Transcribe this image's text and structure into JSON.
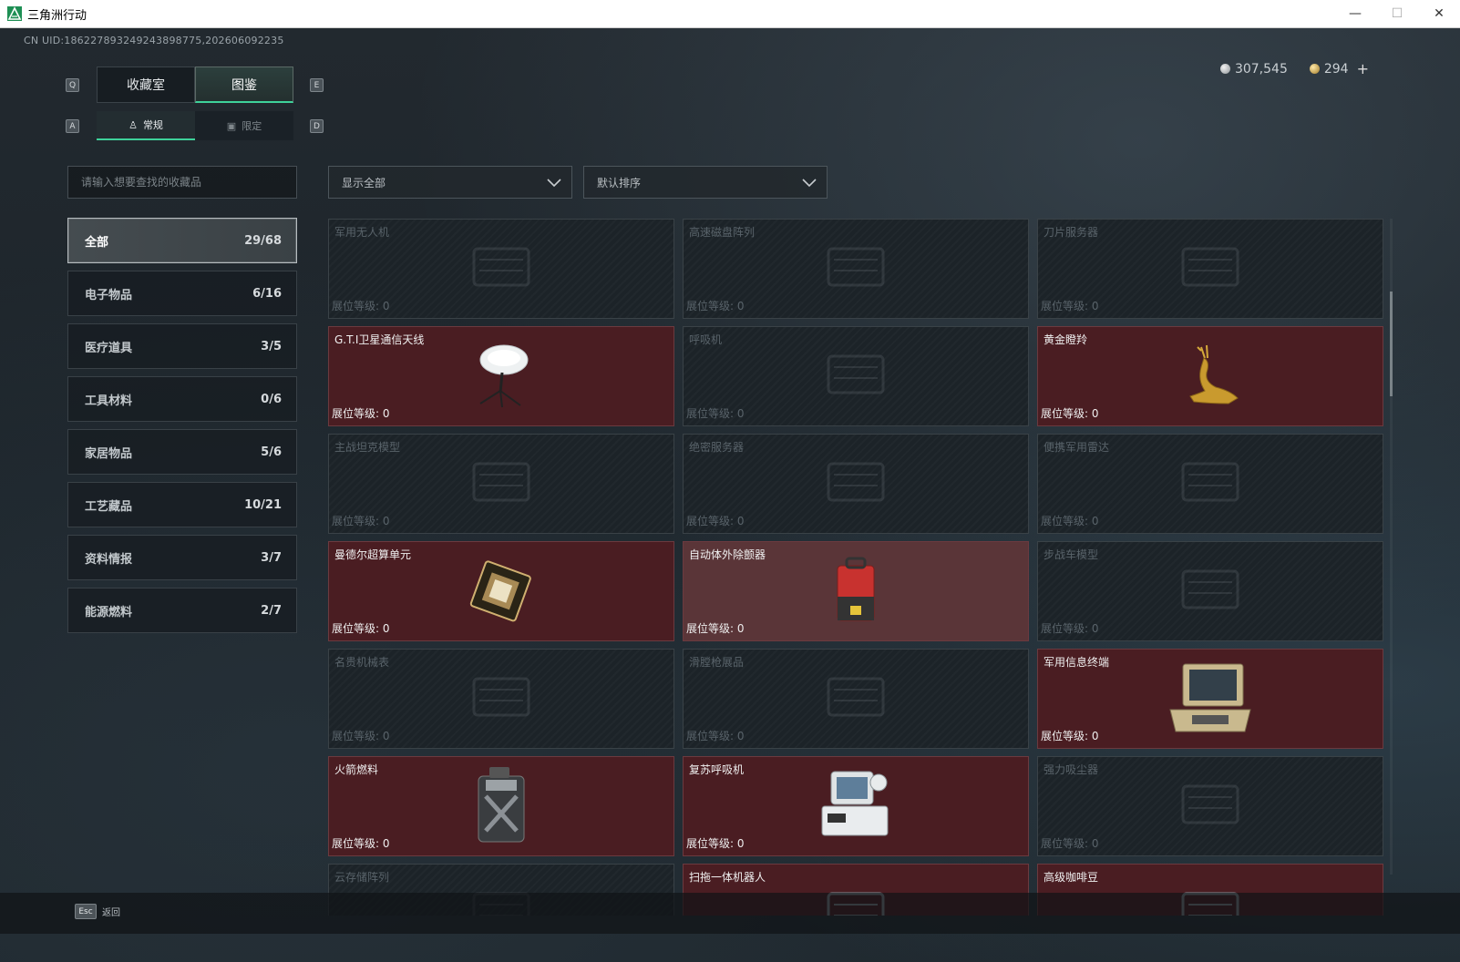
{
  "window": {
    "title": "三角洲行动",
    "controls": {
      "minimize": "—",
      "maximize": "☐",
      "close": "✕"
    }
  },
  "uid": "CN UID:1862278932492438987​75,202606092235",
  "currency": {
    "silver": "307,545",
    "gold": "294",
    "add_label": "+"
  },
  "main_tabs": {
    "left_key": "Q",
    "right_key": "E",
    "items": [
      {
        "label": "收藏室",
        "active": false
      },
      {
        "label": "图鉴",
        "active": true
      }
    ]
  },
  "sub_tabs": {
    "left_key": "A",
    "right_key": "D",
    "items": [
      {
        "label": "常规",
        "icon": "figure-icon",
        "active": true
      },
      {
        "label": "限定",
        "icon": "image-icon",
        "active": false
      }
    ]
  },
  "search": {
    "placeholder": "请输入想要查找的收藏品",
    "value": ""
  },
  "filters": {
    "display": {
      "value": "显示全部"
    },
    "sort": {
      "value": "默认排序"
    }
  },
  "categories": [
    {
      "label": "全部",
      "count": "29/68",
      "active": true
    },
    {
      "label": "电子物品",
      "count": "6/16",
      "active": false
    },
    {
      "label": "医疗道具",
      "count": "3/5",
      "active": false
    },
    {
      "label": "工具材料",
      "count": "0/6",
      "active": false
    },
    {
      "label": "家居物品",
      "count": "5/6",
      "active": false
    },
    {
      "label": "工艺藏品",
      "count": "10/21",
      "active": false
    },
    {
      "label": "资料情报",
      "count": "3/7",
      "active": false
    },
    {
      "label": "能源燃料",
      "count": "2/7",
      "active": false
    }
  ],
  "level_prefix": "展位等级: ",
  "items": [
    {
      "name": "军用无人机",
      "level": "0",
      "owned": false,
      "icon": "drone-icon"
    },
    {
      "name": "高速磁盘阵列",
      "level": "0",
      "owned": false,
      "icon": "disk-array-icon"
    },
    {
      "name": "刀片服务器",
      "level": "0",
      "owned": false,
      "icon": "blade-server-icon"
    },
    {
      "name": "G.T.I卫星通信天线",
      "level": "0",
      "owned": true,
      "icon": "satellite-dish-icon"
    },
    {
      "name": "呼吸机",
      "level": "0",
      "owned": false,
      "icon": "ventilator-icon"
    },
    {
      "name": "黄金瞪羚",
      "level": "0",
      "owned": true,
      "icon": "gazelle-icon"
    },
    {
      "name": "主战坦克模型",
      "level": "0",
      "owned": false,
      "icon": "tank-icon"
    },
    {
      "name": "绝密服务器",
      "level": "0",
      "owned": false,
      "icon": "secret-server-icon"
    },
    {
      "name": "便携军用雷达",
      "level": "0",
      "owned": false,
      "icon": "radar-icon"
    },
    {
      "name": "曼德尔超算单元",
      "level": "0",
      "owned": true,
      "icon": "compute-unit-icon"
    },
    {
      "name": "自动体外除颤器",
      "level": "0",
      "owned": true,
      "light": true,
      "icon": "defibrillator-icon"
    },
    {
      "name": "步战车模型",
      "level": "0",
      "owned": false,
      "icon": "ifv-icon"
    },
    {
      "name": "名贵机械表",
      "level": "0",
      "owned": false,
      "icon": "watch-icon"
    },
    {
      "name": "滑膛枪展品",
      "level": "0",
      "owned": false,
      "icon": "musket-icon"
    },
    {
      "name": "军用信息终端",
      "level": "0",
      "owned": true,
      "icon": "terminal-icon"
    },
    {
      "name": "火箭燃料",
      "level": "0",
      "owned": true,
      "icon": "fuel-can-icon"
    },
    {
      "name": "复苏呼吸机",
      "level": "0",
      "owned": true,
      "icon": "resuscitator-icon"
    },
    {
      "name": "强力吸尘器",
      "level": "0",
      "owned": false,
      "icon": "vacuum-icon"
    },
    {
      "name": "云存储阵列",
      "level": "",
      "owned": false,
      "icon": "cloud-storage-icon"
    },
    {
      "name": "扫拖一体机器人",
      "level": "",
      "owned": true,
      "icon": "robot-vacuum-icon"
    },
    {
      "name": "高级咖啡豆",
      "level": "",
      "owned": true,
      "icon": "coffee-icon"
    }
  ],
  "footer": {
    "key": "Esc",
    "label": "返回"
  },
  "colors": {
    "accent": "#3ed29a",
    "owned_card": "#4a1d22",
    "background": "#1b2228"
  }
}
